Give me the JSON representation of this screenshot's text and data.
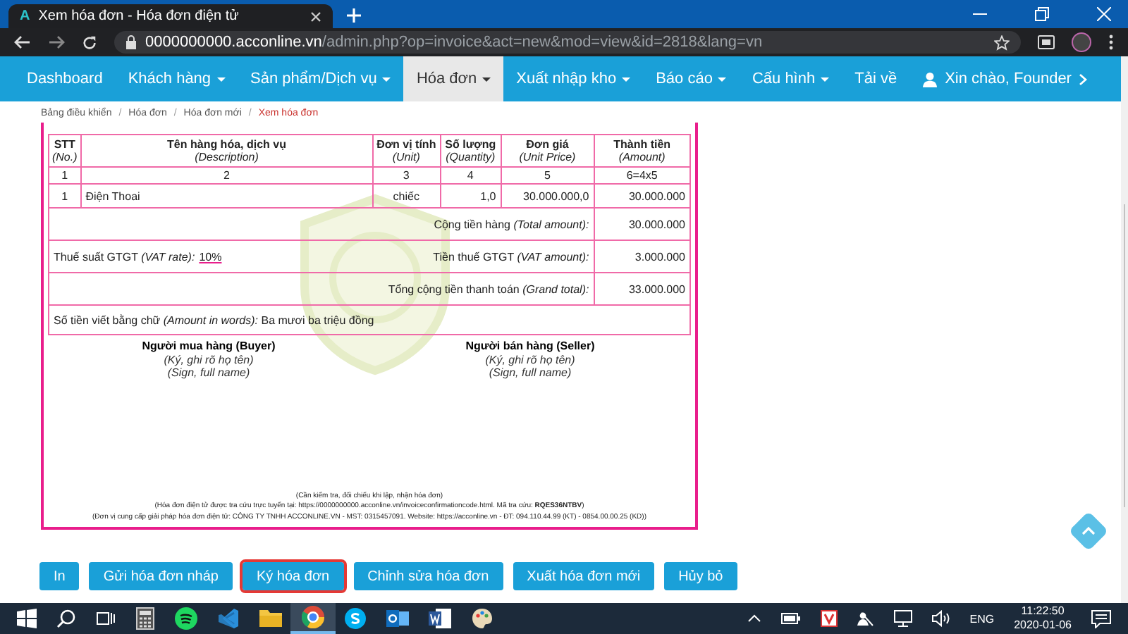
{
  "browser": {
    "favicon": "A",
    "tab_title": "Xem hóa đơn - Hóa đơn điện tử",
    "url_host": "0000000000.acconline.vn",
    "url_path": "/admin.php?op=invoice&act=new&mod=view&id=2818&lang=vn"
  },
  "nav": {
    "items": [
      {
        "label": "Dashboard",
        "dropdown": false,
        "selected": false
      },
      {
        "label": "Khách hàng",
        "dropdown": true,
        "selected": false
      },
      {
        "label": "Sản phẩm/Dịch vụ",
        "dropdown": true,
        "selected": false
      },
      {
        "label": "Hóa đơn",
        "dropdown": true,
        "selected": true
      },
      {
        "label": "Xuất nhập kho",
        "dropdown": true,
        "selected": false
      },
      {
        "label": "Báo cáo",
        "dropdown": true,
        "selected": false
      },
      {
        "label": "Cấu hình",
        "dropdown": true,
        "selected": false
      },
      {
        "label": "Tải về",
        "dropdown": false,
        "selected": false
      }
    ],
    "user": "Xin chào, Founder"
  },
  "breadcrumb_separator": "/",
  "breadcrumb": [
    {
      "label": "Bảng điều khiển",
      "current": false
    },
    {
      "label": "Hóa đơn",
      "current": false
    },
    {
      "label": "Hóa đơn mới",
      "current": false
    },
    {
      "label": "Xem hóa đơn",
      "current": true
    }
  ],
  "invoice": {
    "columns": [
      {
        "title": "STT",
        "subtitle": "(No.)"
      },
      {
        "title": "Tên hàng hóa, dịch vụ",
        "subtitle": "(Description)"
      },
      {
        "title": "Đơn vị tính",
        "subtitle": "(Unit)"
      },
      {
        "title": "Số lượng",
        "subtitle": "(Quantity)"
      },
      {
        "title": "Đơn giá",
        "subtitle": "(Unit Price)"
      },
      {
        "title": "Thành tiền",
        "subtitle": "(Amount)"
      }
    ],
    "index_row": [
      "1",
      "2",
      "3",
      "4",
      "5",
      "6=4x5"
    ],
    "rows": [
      {
        "no": "1",
        "description": "Điện Thoai",
        "unit": "chiếc",
        "quantity": "1,0",
        "unit_price": "30.000.000,0",
        "amount": "30.000.000"
      }
    ],
    "total": {
      "label": "Cộng tiền hàng",
      "label_en": "(Total amount):",
      "value": "30.000.000"
    },
    "vat_rate": {
      "label": "Thuế suất GTGT",
      "label_en": "(VAT rate):",
      "value": "10%"
    },
    "vat_amount": {
      "label": "Tiền thuế GTGT",
      "label_en": "(VAT amount):",
      "value": "3.000.000"
    },
    "grand_total": {
      "label": "Tổng cộng tiền thanh toán",
      "label_en": "(Grand total):",
      "value": "33.000.000"
    },
    "amount_in_words": {
      "label": "Số tiền viết bằng chữ",
      "label_en": "(Amount in words):",
      "value": "Ba mươi ba triệu đồng"
    },
    "signatures": [
      {
        "title": "Người mua hàng (Buyer)",
        "note": "(Ký, ghi rõ họ tên)",
        "note_en": "(Sign, full name)"
      },
      {
        "title": "Người bán hàng (Seller)",
        "note": "(Ký, ghi rõ họ tên)",
        "note_en": "(Sign, full name)"
      }
    ],
    "footer": {
      "check_note": "(Cần kiểm tra, đối chiếu khi lập, nhận hóa đơn)",
      "lookup": "(Hóa đơn điện tử được tra cứu trực tuyến tại: https://0000000000.acconline.vn/invoiceconfirmationcode.html. Mã tra cứu: **RQES36NTBV**)",
      "provider": "(Đơn vị cung cấp giải pháp hóa đơn điện tử: CÔNG TY TNHH ACCONLINE.VN - MST: 0315457091. Website: https://acconline.vn - ĐT: 094.110.44.99 (KT) - 0854.00.00.25 (KD))"
    }
  },
  "actions": [
    {
      "label": "In",
      "highlighted": false
    },
    {
      "label": "Gửi hóa đơn nháp",
      "highlighted": false
    },
    {
      "label": "Ký hóa đơn",
      "highlighted": true
    },
    {
      "label": "Chỉnh sửa hóa đơn",
      "highlighted": false
    },
    {
      "label": "Xuất hóa đơn mới",
      "highlighted": false
    },
    {
      "label": "Hủy bỏ",
      "highlighted": false
    }
  ],
  "taskbar": {
    "language": "ENG",
    "time": "11:22:50",
    "date": "2020-01-06"
  }
}
